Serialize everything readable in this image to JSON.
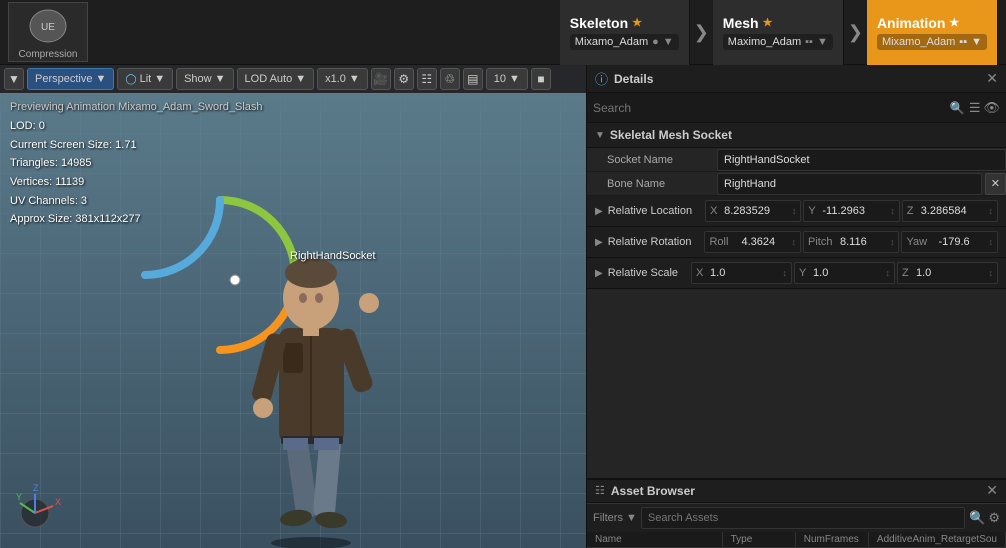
{
  "app": {
    "logo_label": "Compression"
  },
  "pipeline": {
    "tabs": [
      {
        "id": "skeleton",
        "label": "Skeleton",
        "icon": "★",
        "subtitle": "Mixamo_Adam",
        "active": false
      },
      {
        "id": "mesh",
        "label": "Mesh",
        "icon": "★",
        "subtitle": "Maximo_Adam",
        "active": false
      },
      {
        "id": "animation",
        "label": "Animation",
        "icon": "★",
        "subtitle": "Mixamo_Adam",
        "active": true
      }
    ]
  },
  "viewport": {
    "perspective_label": "Perspective",
    "lit_label": "Lit",
    "show_label": "Show",
    "lod_label": "LOD Auto",
    "scale_label": "x1.0",
    "frame_label": "10",
    "previewing_text": "Previewing Animation Mixamo_Adam_Sword_Slash",
    "lod_info": {
      "lod": "LOD: 0",
      "screen_size": "Current Screen Size: 1.71",
      "triangles": "Triangles: 14985",
      "vertices": "Vertices: 11139",
      "uv_channels": "UV Channels: 3",
      "approx_size": "Approx Size: 381x112x277"
    },
    "socket_label": "RightHandSocket"
  },
  "details_panel": {
    "title": "Details",
    "search_placeholder": "Search",
    "section_title": "Skeletal Mesh Socket",
    "fields": {
      "socket_name_label": "Socket Name",
      "socket_name_value": "RightHandSocket",
      "bone_name_label": "Bone Name",
      "bone_name_value": "RightHand",
      "relative_location_label": "Relative Location",
      "rel_loc_x_label": "X",
      "rel_loc_x_val": "8.283529",
      "rel_loc_y_label": "Y",
      "rel_loc_y_val": "-11.2963",
      "rel_loc_z_label": "Z",
      "rel_loc_z_val": "3.286584",
      "relative_rotation_label": "Relative Rotation",
      "rel_rot_roll_label": "Roll",
      "rel_rot_roll_val": "4.3624",
      "rel_rot_pitch_label": "Pitch",
      "rel_rot_pitch_val": "8.116",
      "rel_rot_yaw_label": "Yaw",
      "rel_rot_yaw_val": "-179.6",
      "relative_scale_label": "Relative Scale",
      "rel_scale_x_label": "X",
      "rel_scale_x_val": "1.0",
      "rel_scale_y_label": "Y",
      "rel_scale_y_val": "1.0",
      "rel_scale_z_label": "Z",
      "rel_scale_z_val": "1.0"
    }
  },
  "asset_browser": {
    "title": "Asset Browser",
    "search_placeholder": "Search Assets",
    "columns": [
      {
        "label": "Name"
      },
      {
        "label": "Type"
      },
      {
        "label": "NumFrames"
      },
      {
        "label": "AdditiveAnim_RetargetSou"
      }
    ]
  }
}
